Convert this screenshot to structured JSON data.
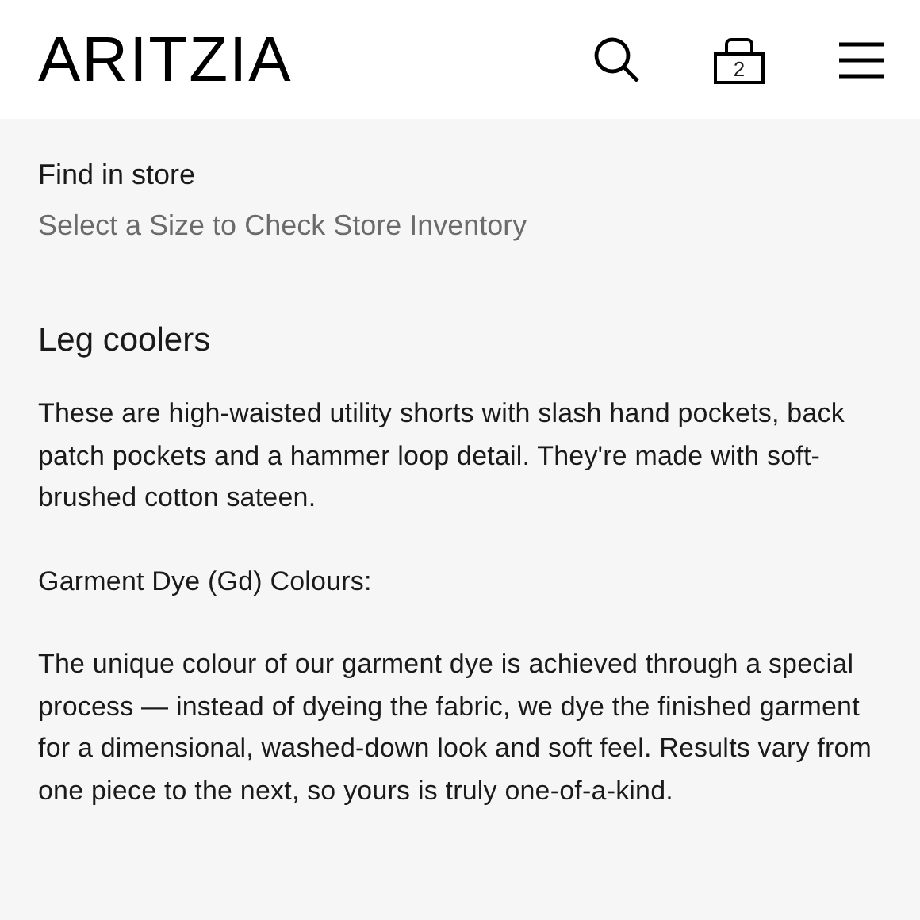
{
  "header": {
    "logo": "ARITZIA",
    "bag_count": "2"
  },
  "store": {
    "title": "Find in store",
    "link": "Select a Size to Check Store Inventory"
  },
  "product": {
    "name": "Leg coolers",
    "paragraphs": [
      "These are high-waisted utility shorts with slash hand pockets, back patch pockets and a hammer loop detail. They're made with soft-brushed cotton sateen.",
      "Garment Dye (Gd) Colours:",
      "The unique colour of our garment dye is achieved through a special process — instead of dyeing the fabric, we dye the finished garment for a dimensional, washed-down look and soft feel. Results vary from one piece to the next, so yours is truly one-of-a-kind."
    ]
  }
}
